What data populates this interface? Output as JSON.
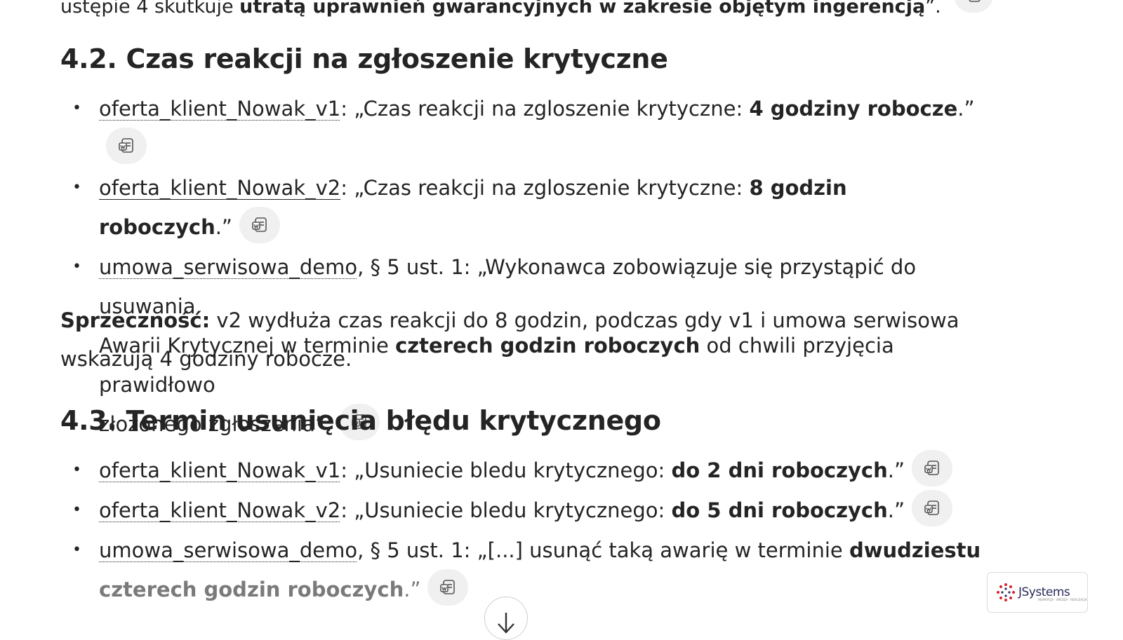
{
  "top_line": {
    "prefix": "ustępie 4 skutkuje ",
    "bold": "utratą uprawnień gwarancyjnych w zakresie objętym ingerencją",
    "suffix": "”."
  },
  "sections": [
    {
      "heading": "4.2. Czas reakcji na zgłoszenie krytyczne",
      "items": [
        {
          "source": "oferta_klient_Nowak_v1",
          "sep": ": „Czas reakcji na zgloszenie krytyczne: ",
          "bold": "4 godziny robocze",
          "tail": ".”"
        },
        {
          "source": "oferta_klient_Nowak_v2",
          "sep": ": „Czas reakcji na zgloszenie krytyczne: ",
          "bold": "8 godzin roboczych",
          "tail": ".”"
        },
        {
          "source": "umowa_serwisowa_demo",
          "line1": ", § 5 ust. 1: „Wykonawca zobowiązuje się przystąpić do usuwania",
          "line2_pre": "Awarii Krytycznej w terminie ",
          "bold": "czterech godzin roboczych",
          "line2_post": " od chwili przyjęcia prawidłowo",
          "line3": "złożonego zgłoszenia”."
        }
      ],
      "conclusion_label": "Sprzeczność:",
      "conclusion_line1": " v2 wydłuża czas reakcji do 8 godzin, podczas gdy v1 i umowa serwisowa",
      "conclusion_line2": "wskazują 4 godziny robocze."
    },
    {
      "heading": "4.3. Termin usunięcia błędu krytycznego",
      "items": [
        {
          "source": "oferta_klient_Nowak_v1",
          "sep": ": „Usuniecie bledu krytycznego: ",
          "bold": "do 2 dni roboczych",
          "tail": ".”"
        },
        {
          "source": "oferta_klient_Nowak_v2",
          "sep": ": „Usuniecie bledu krytycznego: ",
          "bold": "do 5 dni roboczych",
          "tail": ".”"
        },
        {
          "source": "umowa_serwisowa_demo",
          "line1_pre": ", § 5 ust. 1: „[...] usunąć taką awarię w terminie ",
          "line1_bold": "dwudziestu",
          "line2_bold": "czterech godzin roboczych",
          "line2_tail": ".”"
        }
      ]
    }
  ],
  "icons": {
    "citation": "word-document-icon",
    "scroll": "arrow-down-icon"
  },
  "logo": {
    "brand": "JSystems",
    "tagline": "INSPIRACJA · WIEDZA · REALIZACJA"
  },
  "colors": {
    "text": "#242424",
    "pill": "#f0f0f0",
    "faded": "#7a7a7a"
  }
}
